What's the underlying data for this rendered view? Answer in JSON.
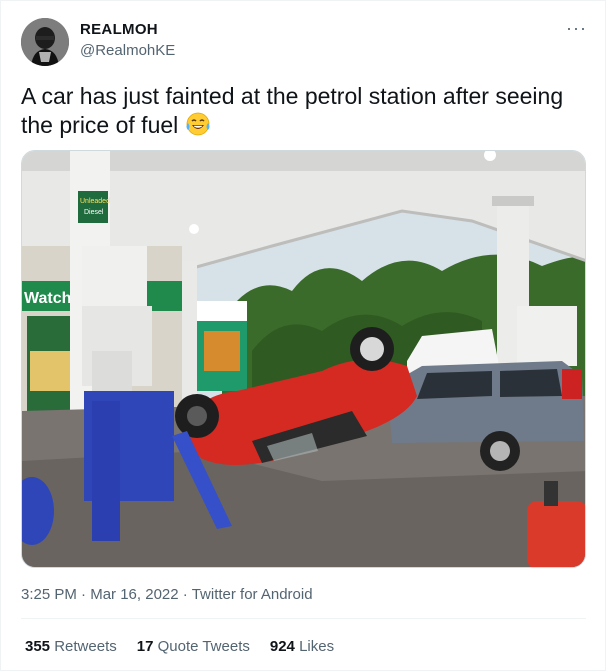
{
  "user": {
    "name": "REALMOH",
    "handle": "@RealmohKE"
  },
  "tweet": {
    "text": "A car has just fainted at the petrol station after seeing the price of fuel",
    "emoji": "face-with-tears-of-joy-icon"
  },
  "image": {
    "sign_text": "Watch",
    "pump_label_1": "Unleaded",
    "pump_label_2": "Diesel"
  },
  "meta": {
    "time": "3:25 PM",
    "sep1": "·",
    "date": "Mar 16, 2022",
    "sep2": "·",
    "source": "Twitter for Android"
  },
  "stats": {
    "retweets_count": "355",
    "retweets_label": "Retweets",
    "quotes_count": "17",
    "quotes_label": "Quote Tweets",
    "likes_count": "924",
    "likes_label": "Likes"
  },
  "colors": {
    "secondary_text": "#536471",
    "primary_text": "#0f1419",
    "car_red": "#d42a22"
  }
}
